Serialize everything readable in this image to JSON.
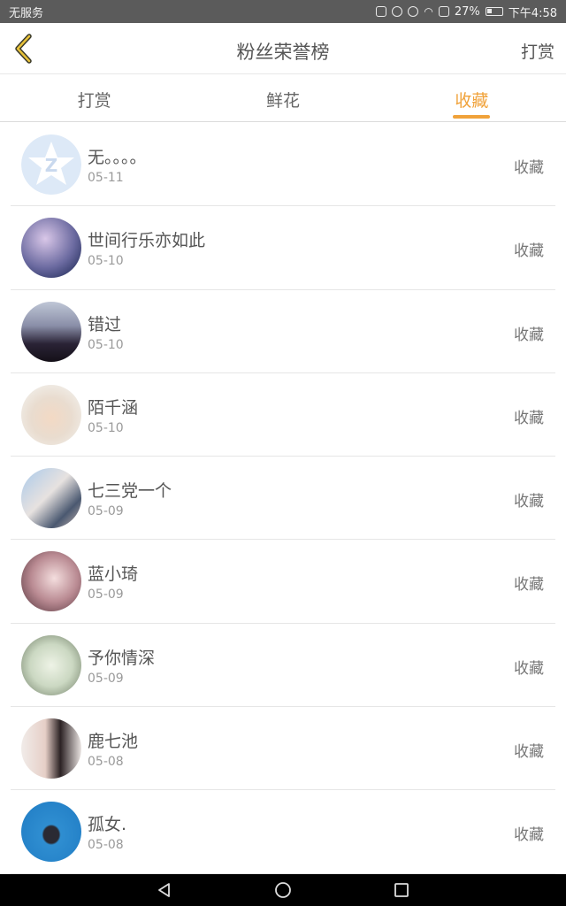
{
  "status_bar": {
    "carrier": "无服务",
    "battery": "27%",
    "time": "下午4:58"
  },
  "header": {
    "title": "粉丝荣誉榜",
    "action": "打赏"
  },
  "tabs": [
    {
      "label": "打赏",
      "active": false
    },
    {
      "label": "鲜花",
      "active": false
    },
    {
      "label": "收藏",
      "active": true
    }
  ],
  "colors": {
    "accent": "#f0a23a",
    "status_bar": "#5b5b5b",
    "nav_bar": "#000000"
  },
  "list": [
    {
      "name": "无。。。。",
      "date": "05-11",
      "action": "收藏"
    },
    {
      "name": "世间行乐亦如此",
      "date": "05-10",
      "action": "收藏"
    },
    {
      "name": "错过",
      "date": "05-10",
      "action": "收藏"
    },
    {
      "name": "陌千涵",
      "date": "05-10",
      "action": "收藏"
    },
    {
      "name": "七三党一个",
      "date": "05-09",
      "action": "收藏"
    },
    {
      "name": "蓝小琦",
      "date": "05-09",
      "action": "收藏"
    },
    {
      "name": "予你情深",
      "date": "05-09",
      "action": "收藏"
    },
    {
      "name": "鹿七池",
      "date": "05-08",
      "action": "收藏"
    },
    {
      "name": "孤女.",
      "date": "05-08",
      "action": "收藏"
    }
  ]
}
